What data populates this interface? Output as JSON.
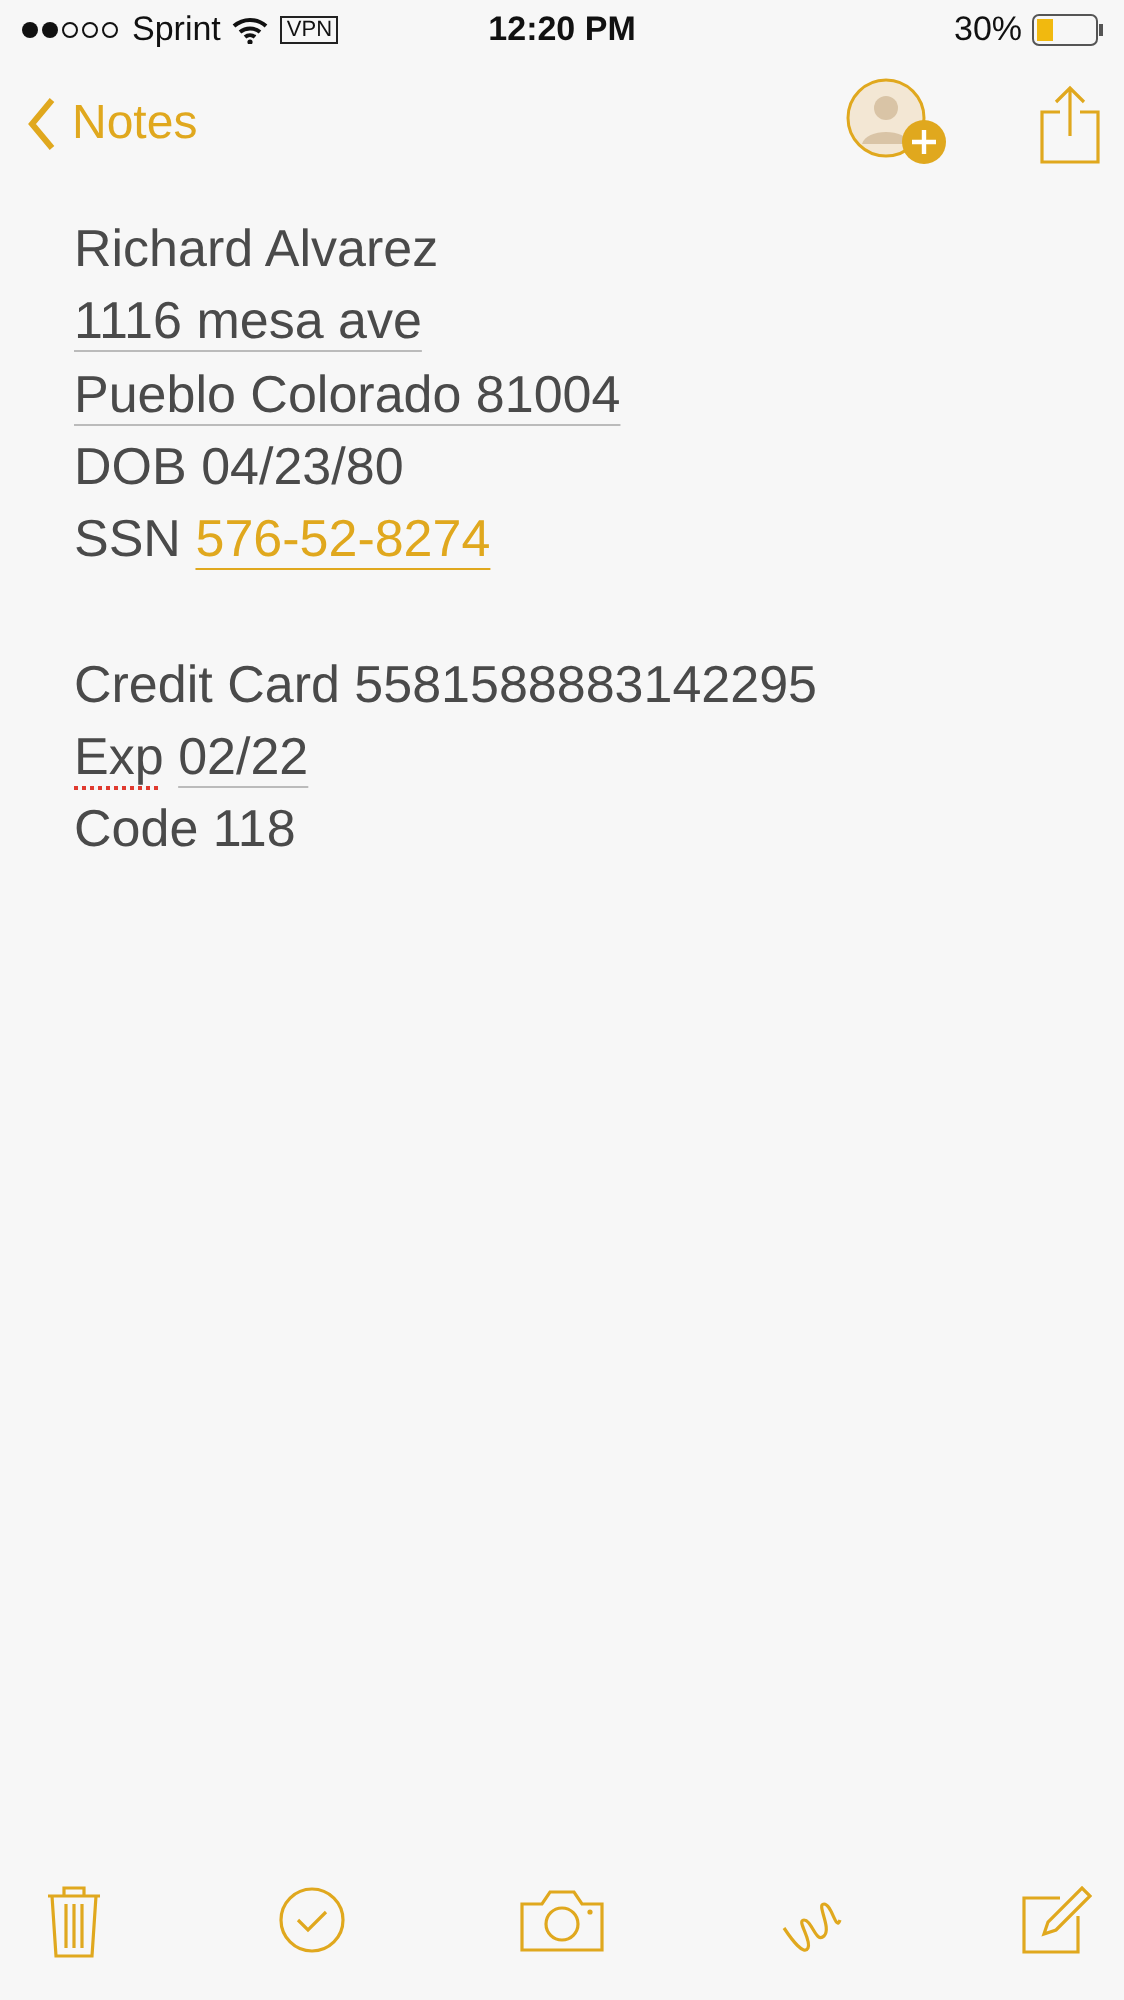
{
  "status_bar": {
    "carrier": "Sprint",
    "vpn": "VPN",
    "time": "12:20 PM",
    "battery": "30%"
  },
  "nav_bar": {
    "back_label": "Notes"
  },
  "note": {
    "lines": [
      {
        "segments": [
          {
            "text": "Richard Alvarez",
            "kind": "plain"
          }
        ]
      },
      {
        "segments": [
          {
            "text": "1116 mesa ave",
            "kind": "detected"
          }
        ]
      },
      {
        "segments": [
          {
            "text": "Pueblo Colorado 81004",
            "kind": "detected"
          }
        ]
      },
      {
        "segments": [
          {
            "text": "DOB 04/23/80",
            "kind": "plain"
          }
        ]
      },
      {
        "segments": [
          {
            "text": "SSN",
            "kind": "plain"
          },
          {
            "text": "576-52-8274",
            "kind": "link"
          }
        ]
      },
      {
        "gap_before": true,
        "segments": [
          {
            "text": "Credit Card 5581588883142295",
            "kind": "plain"
          }
        ]
      },
      {
        "segments": [
          {
            "text": "Exp",
            "kind": "misspelled"
          },
          {
            "text": "02/22",
            "kind": "detected"
          }
        ]
      },
      {
        "segments": [
          {
            "text": "Code 118",
            "kind": "plain"
          }
        ]
      }
    ]
  }
}
